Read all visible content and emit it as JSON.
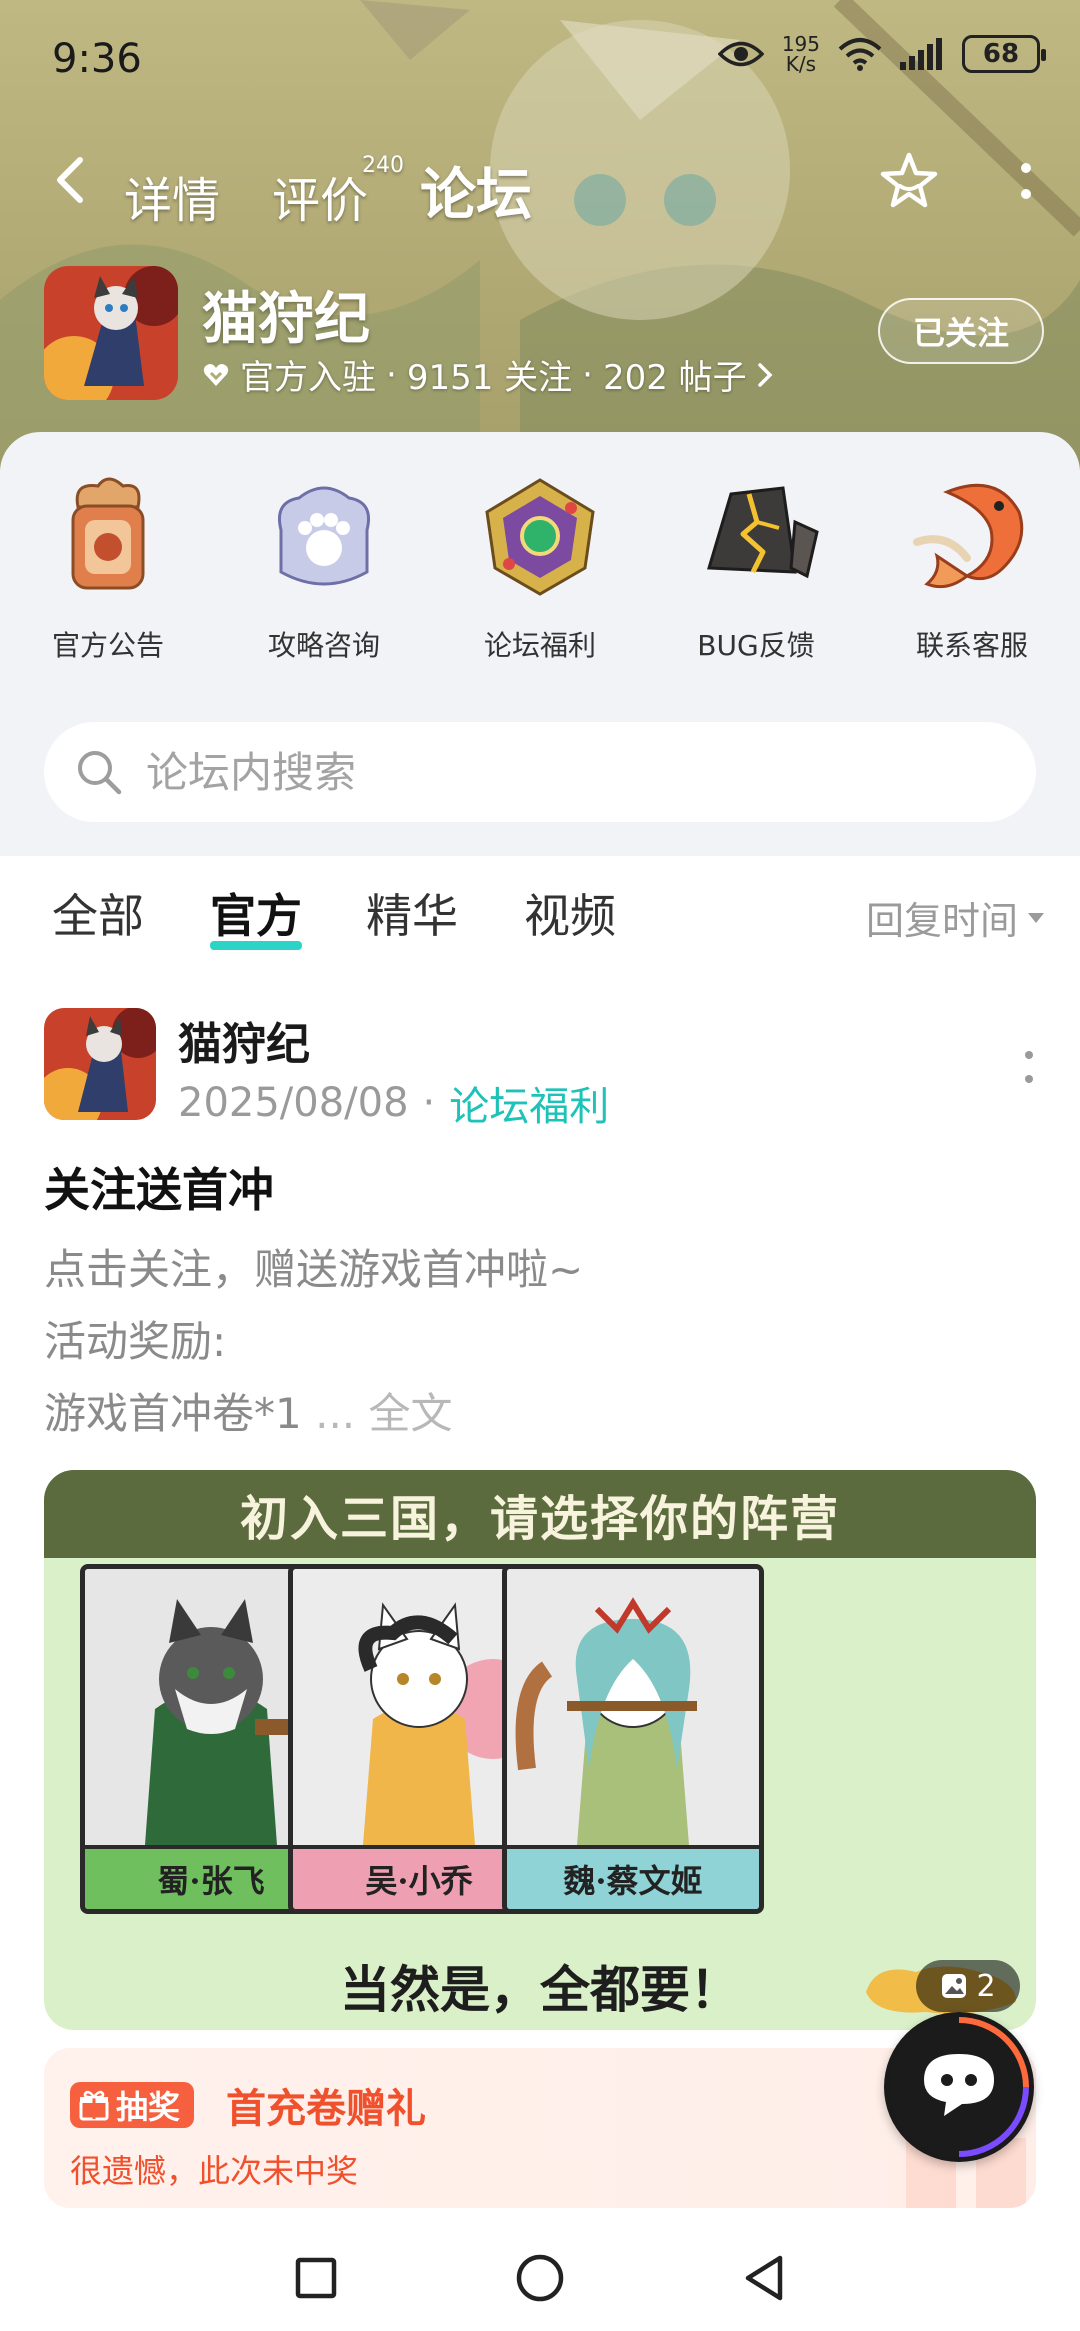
{
  "status_bar": {
    "time": "9:36",
    "net_speed_value": "195",
    "net_speed_unit": "K/s",
    "battery": "68"
  },
  "nav": {
    "tabs": [
      {
        "label": "详情",
        "active": false
      },
      {
        "label": "评价",
        "active": false,
        "badge": "240"
      },
      {
        "label": "论坛",
        "active": true
      }
    ]
  },
  "game": {
    "title": "猫狩纪",
    "official_label": "官方入驻",
    "followers": "9151 关注",
    "posts": "202 帖子",
    "follow_button": "已关注"
  },
  "entries": [
    {
      "label": "官方公告",
      "icon": "announcement-badge-icon"
    },
    {
      "label": "攻略咨询",
      "icon": "paw-guide-icon"
    },
    {
      "label": "论坛福利",
      "icon": "gem-gift-icon"
    },
    {
      "label": "BUG反馈",
      "icon": "cracked-stone-icon"
    },
    {
      "label": "联系客服",
      "icon": "koi-fish-icon"
    }
  ],
  "search": {
    "placeholder": "论坛内搜索"
  },
  "filters": {
    "tabs": [
      {
        "label": "全部",
        "active": false
      },
      {
        "label": "官方",
        "active": true
      },
      {
        "label": "精华",
        "active": false
      },
      {
        "label": "视频",
        "active": false
      }
    ],
    "sort_label": "回复时间"
  },
  "post": {
    "author": "猫狩纪",
    "date": "2025/08/08",
    "category": "论坛福利",
    "title": "关注送首冲",
    "body_lines": [
      "点击关注，赠送游戏首冲啦~",
      "活动奖励:",
      "游戏首冲卷*1"
    ],
    "ellipsis": "...",
    "full_text_link": "全文",
    "banner": {
      "heading": "初入三国，请选择你的阵营",
      "cards": [
        {
          "label": "蜀·张飞",
          "color": "#6fbf5e"
        },
        {
          "label": "吴·小乔",
          "color": "#ef9fb2"
        },
        {
          "label": "魏·蔡文姬",
          "color": "#8fd3d6"
        }
      ],
      "footer": "当然是，全都要！",
      "image_count": "2"
    },
    "lottery": {
      "tag": "抽奖",
      "title": "首充卷赠礼",
      "result": "很遗憾，此次未中奖"
    }
  },
  "colors": {
    "accent": "#2bd4c7",
    "category": "#1ec2b8",
    "lottery": "#f0502c"
  }
}
